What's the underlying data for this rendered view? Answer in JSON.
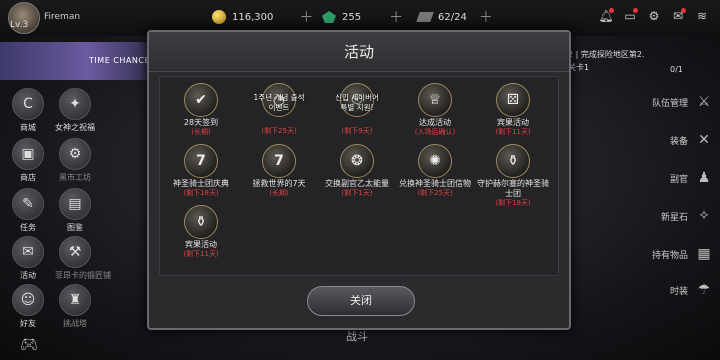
{
  "player": {
    "level": "Lv.3",
    "name": "Fireman"
  },
  "resources": {
    "gold": "116,300",
    "gems": "255",
    "energy": "62/24"
  },
  "banner": {
    "text": "TIME CHANCE"
  },
  "quest": {
    "line1": "2-2 | 完成探险地区第2.",
    "line2": "次关卡1",
    "progress": "0/1"
  },
  "left_menu": [
    {
      "label": "商城",
      "icon": "C"
    },
    {
      "label": "女神之祝福",
      "icon": "✦"
    },
    {
      "label": "商店",
      "icon": "▣"
    },
    {
      "label": "黑市工坊",
      "icon": "⚙"
    },
    {
      "label": "任务",
      "icon": "✎"
    },
    {
      "label": "图鉴",
      "icon": "▤"
    },
    {
      "label": "活动",
      "icon": "✉"
    },
    {
      "label": "菲昂卡的锻匠铺",
      "icon": "⚒"
    },
    {
      "label": "好友",
      "icon": "☺"
    },
    {
      "label": "挑战塔",
      "icon": "♜"
    }
  ],
  "right_menu": [
    {
      "label": "队伍管理",
      "icon": "⚔"
    },
    {
      "label": "装备",
      "icon": "✕"
    },
    {
      "label": "副官",
      "icon": "♟"
    },
    {
      "label": "新星石",
      "icon": "✧"
    },
    {
      "label": "持有物品",
      "icon": "▦"
    },
    {
      "label": "时装",
      "icon": "☂"
    }
  ],
  "bottom": {
    "battle": "战斗"
  },
  "modal": {
    "title": "活动",
    "close_label": "关闭",
    "events": [
      {
        "name": "28天签到",
        "sub": "(长期)",
        "icon": "✔",
        "overlay": ""
      },
      {
        "name": "",
        "sub": "(剩下25天)",
        "icon": "◔",
        "overlay": "1주년 개념 출석\n이벤트"
      },
      {
        "name": "",
        "sub": "(剩下9天)",
        "icon": "☉",
        "overlay": "신입 세이버어\n특별 지원!"
      },
      {
        "name": "达成活动",
        "sub": "(入场后确认)",
        "icon": "♕",
        "overlay": ""
      },
      {
        "name": "宾果活动",
        "sub": "(剩下11天)",
        "icon": "⚄",
        "overlay": ""
      },
      {
        "name": "神圣骑士团庆典",
        "sub": "(剩下18天)",
        "icon": "7",
        "overlay": ""
      },
      {
        "name": "拯救世界的7天",
        "sub": "(长期)",
        "icon": "7",
        "overlay": ""
      },
      {
        "name": "交换副官乙太能量",
        "sub": "(剩下1天)",
        "icon": "❂",
        "overlay": ""
      },
      {
        "name": "兑换神圣骑士团信物",
        "sub": "(剩下25天)",
        "icon": "✺",
        "overlay": ""
      },
      {
        "name": "守护赫尔塞的神圣骑士团",
        "sub": "(剩下18天)",
        "icon": "⚱",
        "overlay": ""
      },
      {
        "name": "宾果活动",
        "sub": "(剩下11天)",
        "icon": "⚱",
        "overlay": ""
      }
    ]
  }
}
